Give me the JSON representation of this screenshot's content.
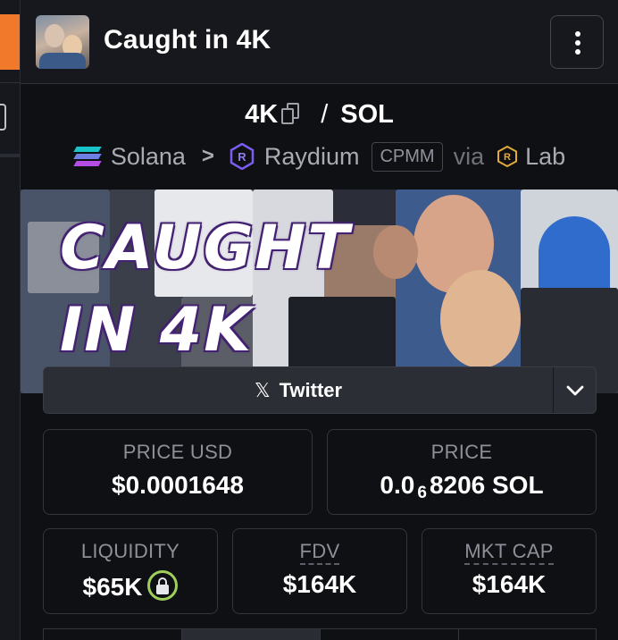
{
  "header": {
    "title": "Caught in 4K",
    "avatar_icon": "token-avatar-icon",
    "menu_icon": "kebab-menu-icon"
  },
  "pair": {
    "base": "4K",
    "separator": "/",
    "quote": "SOL",
    "copy_icon": "copy-icon"
  },
  "chain": {
    "name": "Solana",
    "dex": "Raydium",
    "badge": "CPMM",
    "via_label": "via",
    "via_name": "Lab"
  },
  "banner": {
    "line1": "CAUGHT",
    "line2": "IN 4K"
  },
  "social": {
    "label": "Twitter",
    "icon": "x-logo-icon",
    "dropdown_icon": "chevron-down-icon"
  },
  "stats": {
    "price_usd": {
      "label": "PRICE USD",
      "value": "$0.0001648"
    },
    "price": {
      "label": "PRICE",
      "value_prefix": "0.0",
      "value_sub": "6",
      "value_suffix": "8206 SOL"
    },
    "liquidity": {
      "label": "LIQUIDITY",
      "value": "$65K"
    },
    "fdv": {
      "label": "FDV",
      "value": "$164K"
    },
    "mkt_cap": {
      "label": "MKT CAP",
      "value": "$164K"
    }
  },
  "colors": {
    "accent_orange": "#f0792c",
    "lock_ring": "#9fcf5a",
    "background": "#0f1014"
  }
}
